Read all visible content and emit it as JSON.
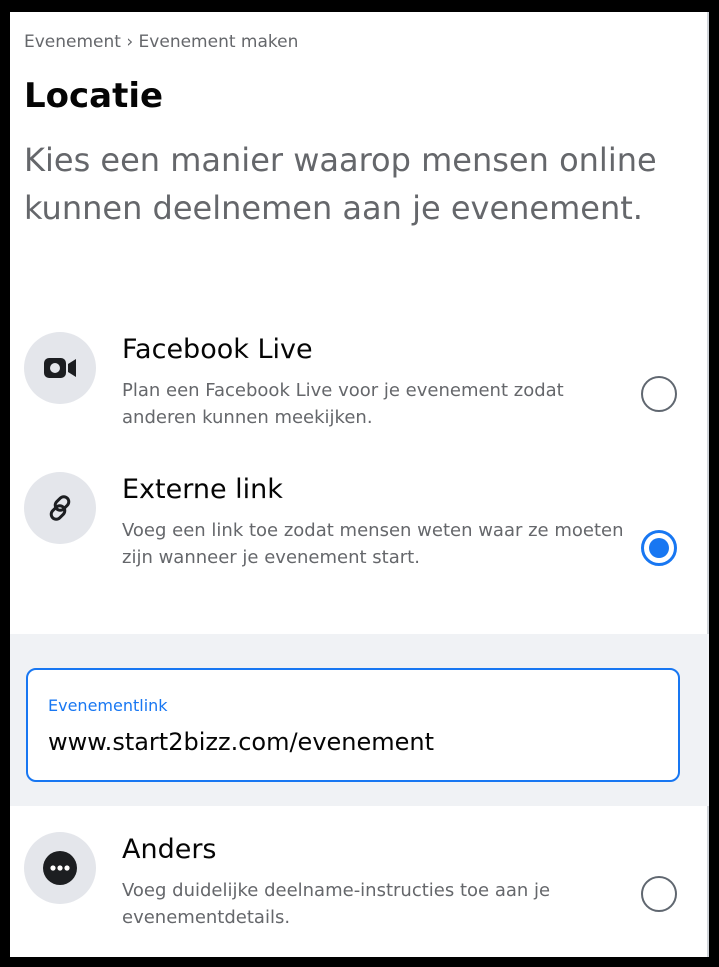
{
  "breadcrumb": "Evenement › Evenement maken",
  "title": "Locatie",
  "subtitle": "Kies een manier waarop mensen online kunnen deelnemen aan je evenement.",
  "options": [
    {
      "title": "Facebook Live",
      "description": "Plan een Facebook Live voor je evenement zodat anderen kunnen meekijken.",
      "icon": "video-camera-icon",
      "selected": false
    },
    {
      "title": "Externe link",
      "description": "Voeg een link toe zodat mensen weten waar ze moeten zijn wanneer je evenement start.",
      "icon": "link-icon",
      "selected": true
    },
    {
      "title": "Anders",
      "description": "Voeg duidelijke deelname-instructies toe aan je evenementdetails.",
      "icon": "more-icon",
      "selected": false
    }
  ],
  "event_link": {
    "label": "Evenementlink",
    "value": "www.start2bizz.com/evenement"
  },
  "colors": {
    "accent": "#1877f2",
    "secondary_text": "#65676b",
    "icon_background": "#e4e6eb",
    "band_background": "#f0f2f5"
  }
}
